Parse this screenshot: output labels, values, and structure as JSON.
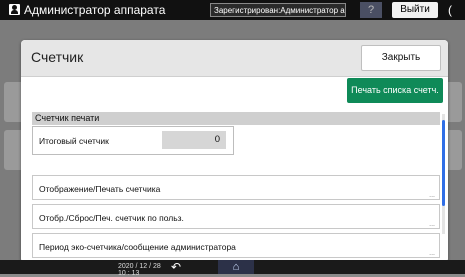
{
  "topbar": {
    "title": "Администратор аппарата",
    "login_status": "Зарегистрирован:Администратор аппарат",
    "help_glyph": "?",
    "logout_label": "Выйти",
    "icons": [
      "user-icon",
      "help-icon",
      "power-icon"
    ]
  },
  "dialog": {
    "title": "Счетчик",
    "close_label": "Закрыть",
    "print_list_label": "Печать списка счетч.",
    "section_title": "Счетчик печати",
    "total_counter_label": "Итоговый счетчик",
    "total_counter_value": "0",
    "menu_items": [
      {
        "label": "Отображение/Печать счетчика"
      },
      {
        "label": "Отобр./Сброс/Печ. счетчик по польз."
      },
      {
        "label": "Период эко-счетчика/сообщение администратора"
      }
    ],
    "more_glyph": "..."
  },
  "bottombar": {
    "date": "2020 / 12 / 28",
    "time": "10 : 13",
    "icons": [
      "back-icon",
      "home-icon"
    ]
  },
  "colors": {
    "accent_green": "#0f8a58",
    "scroll_blue": "#2f6ee6",
    "topbar_bg": "#111111"
  }
}
